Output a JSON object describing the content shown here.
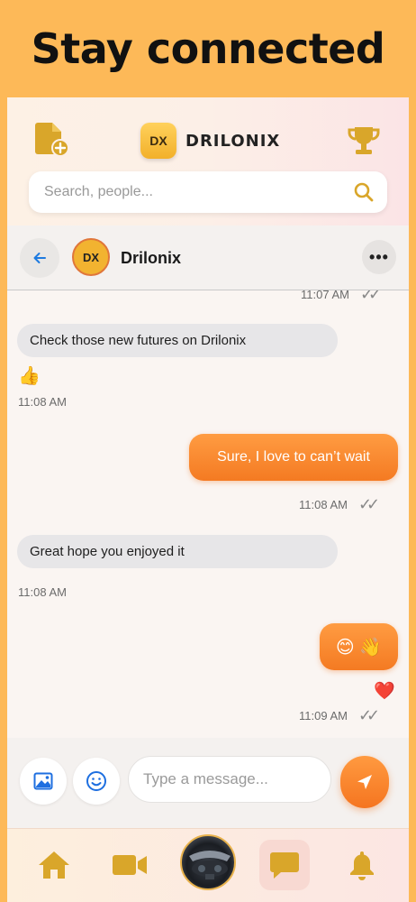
{
  "headline": "Stay connected",
  "app": {
    "brand_logo": "DX",
    "brand_name": "DRILONIX"
  },
  "search": {
    "placeholder": "Search, people..."
  },
  "chat": {
    "contact_avatar": "DX",
    "contact_name": "Drilonix",
    "more_label": "•••",
    "messages": [
      {
        "direction": "outgoing",
        "time": "11:07 AM",
        "ticks": "✓✓",
        "partial": true
      },
      {
        "direction": "incoming",
        "text": "Check those new futures on Drilonix",
        "reaction": "👍",
        "time": "11:08 AM"
      },
      {
        "direction": "outgoing",
        "text": "Sure, I love to can’t wait",
        "time": "11:08 AM",
        "ticks": "✓✓"
      },
      {
        "direction": "incoming",
        "text": "Great hope you enjoyed it",
        "time": "11:08 AM"
      },
      {
        "direction": "outgoing",
        "text": "😊 👋",
        "reaction": "❤️",
        "time": "11:09 AM",
        "ticks": "✓✓"
      }
    ]
  },
  "composer": {
    "placeholder": "Type a message..."
  },
  "nav": {
    "items": [
      "home-icon",
      "video-icon",
      "profile-avatar",
      "chat-icon",
      "bell-icon"
    ],
    "active": "chat-icon"
  },
  "colors": {
    "accent_orange": "#F47A22",
    "accent_gold": "#D9A62A",
    "background": "#FDB958"
  }
}
